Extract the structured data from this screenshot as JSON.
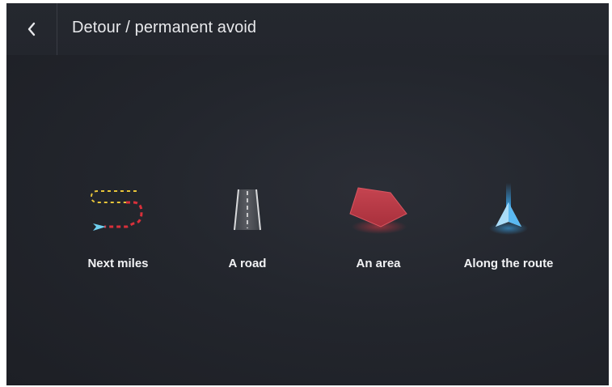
{
  "header": {
    "title": "Detour / permanent avoid",
    "back_icon": "chevron-left-icon"
  },
  "options": [
    {
      "label": "Next miles",
      "icon": "dashed-route-icon"
    },
    {
      "label": "A road",
      "icon": "road-icon"
    },
    {
      "label": "An area",
      "icon": "area-polygon-icon"
    },
    {
      "label": "Along the route",
      "icon": "navigation-arrow-icon"
    }
  ],
  "colors": {
    "background": "#23262d",
    "text": "#f2f3f5",
    "area_red": "#c8404a",
    "route_yellow": "#e8c53a",
    "route_red": "#d8303a",
    "nav_blue": "#3aa8f0"
  }
}
